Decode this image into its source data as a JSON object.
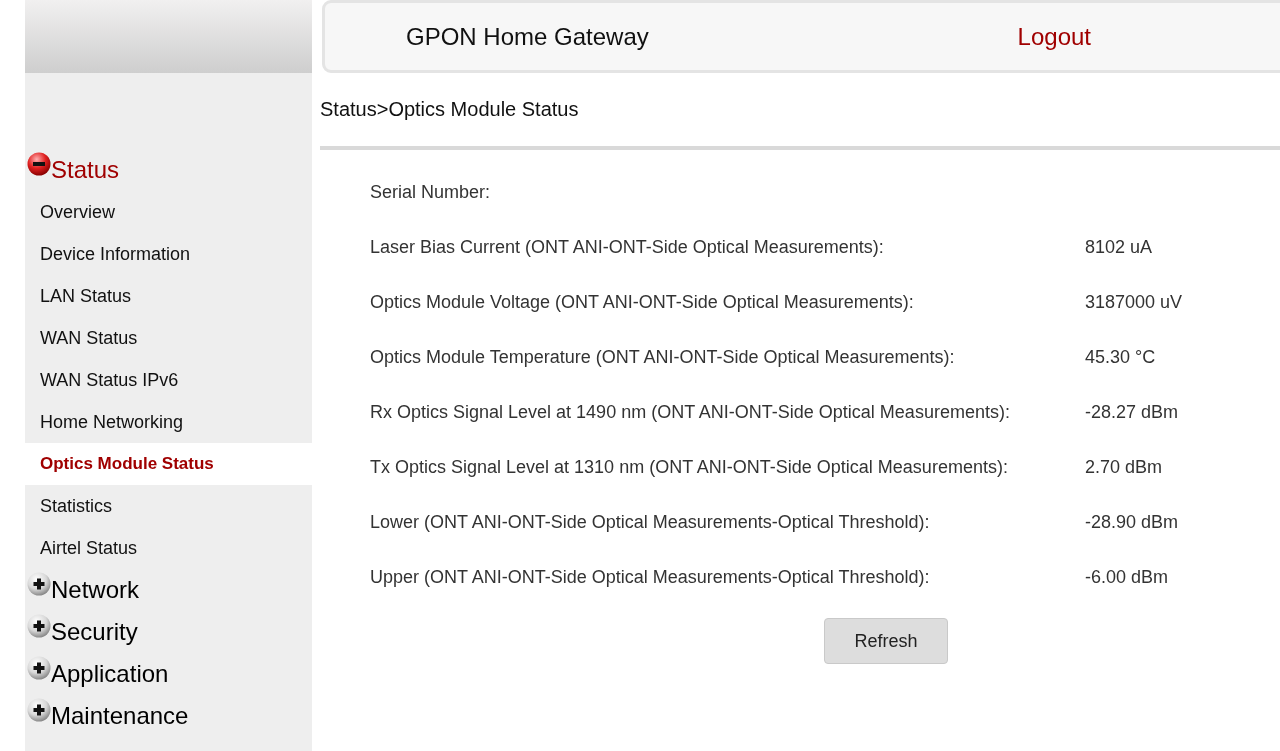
{
  "header": {
    "title": "GPON Home Gateway",
    "logout": "Logout"
  },
  "sidebar": {
    "groups": [
      {
        "label": "Status",
        "expanded": true,
        "children": [
          {
            "label": "Overview",
            "selected": false
          },
          {
            "label": "Device Information",
            "selected": false
          },
          {
            "label": "LAN Status",
            "selected": false
          },
          {
            "label": "WAN Status",
            "selected": false
          },
          {
            "label": "WAN Status IPv6",
            "selected": false
          },
          {
            "label": "Home Networking",
            "selected": false
          },
          {
            "label": "Optics Module Status",
            "selected": true
          },
          {
            "label": "Statistics",
            "selected": false
          },
          {
            "label": "Airtel Status",
            "selected": false
          }
        ]
      },
      {
        "label": "Network",
        "expanded": false
      },
      {
        "label": "Security",
        "expanded": false
      },
      {
        "label": "Application",
        "expanded": false
      },
      {
        "label": "Maintenance",
        "expanded": false
      }
    ]
  },
  "breadcrumb": "Status>Optics Module Status",
  "fields": [
    {
      "label": "Serial Number:"
    },
    {
      "label": "Laser Bias Current (ONT ANI-ONT-Side Optical Measurements):",
      "value": "8102 uA"
    },
    {
      "label": "Optics Module Voltage (ONT ANI-ONT-Side Optical Measurements):",
      "value": "3187000 uV"
    },
    {
      "label": "Optics Module Temperature (ONT ANI-ONT-Side Optical Measurements):",
      "value": "45.30 °C"
    },
    {
      "label": "Rx Optics Signal Level at 1490 nm (ONT ANI-ONT-Side Optical Measurements):",
      "value": "-28.27 dBm"
    },
    {
      "label": "Tx Optics Signal Level at 1310 nm (ONT ANI-ONT-Side Optical Measurements):",
      "value": "2.70 dBm"
    },
    {
      "label": "Lower (ONT ANI-ONT-Side Optical Measurements-Optical Threshold):",
      "value": "-28.90 dBm"
    },
    {
      "label": "Upper (ONT ANI-ONT-Side Optical Measurements-Optical Threshold):",
      "value": "-6.00 dBm"
    }
  ],
  "buttons": [
    "Refresh"
  ]
}
